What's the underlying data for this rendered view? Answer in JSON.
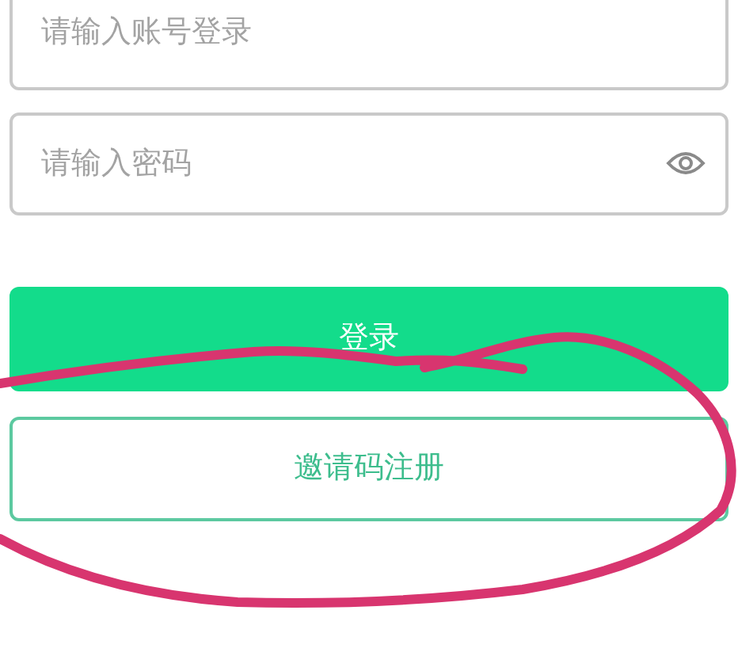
{
  "account_field": {
    "placeholder": "请输入账号登录"
  },
  "password_field": {
    "placeholder": "请输入密码"
  },
  "login_button": {
    "label": "登录"
  },
  "register_button": {
    "label": "邀请码注册"
  },
  "annotation": {
    "kind": "hand-drawn-circle"
  }
}
